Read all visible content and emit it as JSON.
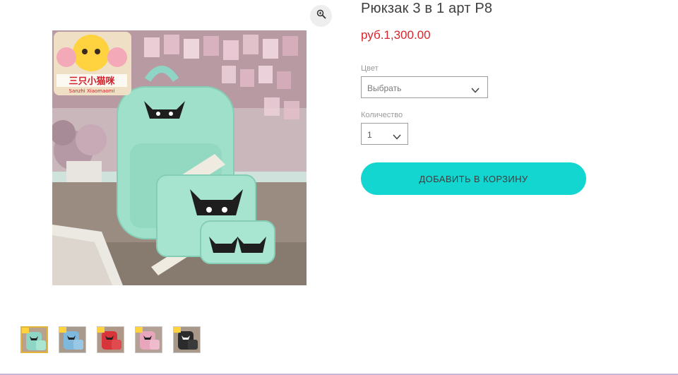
{
  "product": {
    "title": "Рюкзак 3 в 1 арт Р8",
    "price": "руб.1,300.00",
    "image_alt": "Рюкзак 3 в 1 — мятный набор с котиками",
    "logo_text": "Sanzhi Xiaomaomi"
  },
  "options": {
    "color_label": "Цвет",
    "color_value": "Выбрать",
    "quantity_label": "Количество",
    "quantity_value": "1"
  },
  "actions": {
    "add_to_cart": "ДОБАВИТЬ В КОРЗИНУ"
  },
  "gallery": {
    "thumbnails": [
      {
        "color": "#8fd5c5",
        "selected": true
      },
      {
        "color": "#7fb8dd",
        "selected": false
      },
      {
        "color": "#d8353a",
        "selected": false
      },
      {
        "color": "#e8a6bd",
        "selected": false
      },
      {
        "color": "#2b2b2b",
        "selected": false
      }
    ]
  },
  "colors": {
    "price": "#d8242c",
    "button": "#13d6d1",
    "selected_thumb_border": "#e3b53a",
    "bag_mint": "#9fe0ca"
  },
  "icons": {
    "zoom": "magnifier-icon",
    "dropdown": "chevron-down-icon"
  }
}
